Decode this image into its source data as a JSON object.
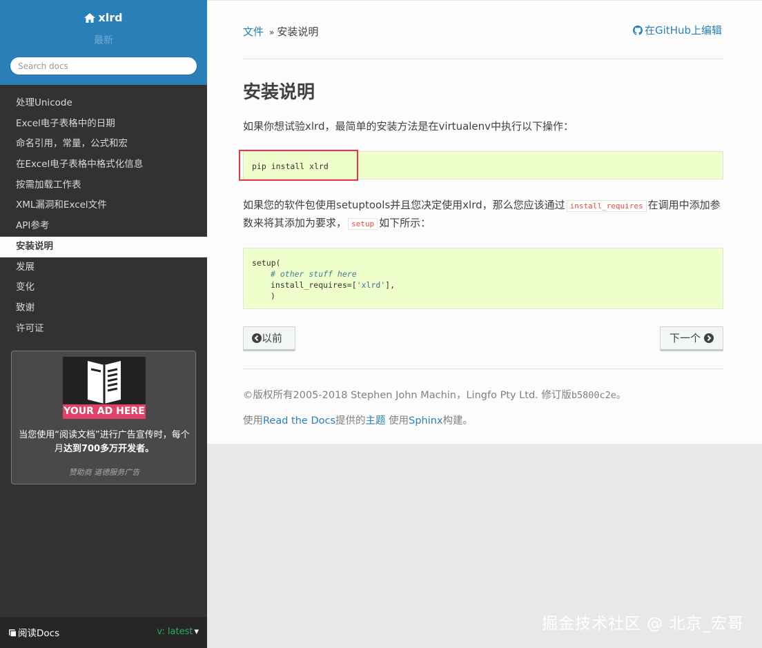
{
  "sidebar": {
    "project": "xlrd",
    "version": "最新",
    "search_placeholder": "Search docs",
    "nav": [
      {
        "label": "处理Unicode",
        "current": false
      },
      {
        "label": "Excel电子表格中的日期",
        "current": false
      },
      {
        "label": "命名引用，常量，公式和宏",
        "current": false
      },
      {
        "label": "在Excel电子表格中格式化信息",
        "current": false
      },
      {
        "label": "按需加载工作表",
        "current": false
      },
      {
        "label": "XML漏洞和Excel文件",
        "current": false
      },
      {
        "label": "API参考",
        "current": false
      },
      {
        "label": "安装说明",
        "current": true
      },
      {
        "label": "发展",
        "current": false
      },
      {
        "label": "变化",
        "current": false
      },
      {
        "label": "致谢",
        "current": false
      },
      {
        "label": "许可证",
        "current": false
      }
    ],
    "ad": {
      "banner": "YOUR AD HERE",
      "text_prefix": "当您使用“阅读文档”进行广告宣传时，每个月",
      "text_bold": "达到700多万开发者。",
      "footer": "赞助商 道德服务广告"
    },
    "footer": {
      "left": "阅读Docs",
      "version_prefix": "v:",
      "version": "latest"
    }
  },
  "content": {
    "breadcrumb_home": "文件",
    "breadcrumb_sep": "»",
    "breadcrumb_current": "安装说明",
    "edit_link": "在GitHub上编辑",
    "title": "安装说明",
    "para1": "如果你想试验xlrd，最简单的安装方法是在virtualenv中执行以下操作：",
    "code1": "pip install xlrd",
    "para2_a": "如果您的软件包使用setuptools并且您决定使用xlrd，那么您应该通过",
    "para2_code1": "install_requires",
    "para2_b": "在调用中添加参数来将其添加为要求，",
    "para2_code2": "setup",
    "para2_c": "如下所示：",
    "code2": {
      "line1": "setup(",
      "comment": "# other stuff here",
      "line3_a": "install_requires=[",
      "line3_str": "'xlrd'",
      "line3_b": "],",
      "line4": ")"
    },
    "prev_label": "以前",
    "next_label": "下一个",
    "footer_copyright": "©版权所有2005-2018 Stephen John Machin，Lingfo Pty Ltd. 修订版",
    "footer_revision": "b5800c2e",
    "footer_end": "。",
    "footer_built_a": "使用",
    "footer_rtd": "Read the Docs",
    "footer_built_b": "提供的",
    "footer_theme": "主题",
    "footer_built_c": " 使用",
    "footer_sphinx": "Sphinx",
    "footer_built_d": "构建。"
  },
  "watermark": "掘金技术社区 @ 北京_宏哥",
  "colors": {
    "sidebar_head": "#2980b9",
    "sidebar_bg": "#343131",
    "code_bg": "#eeffcc",
    "link": "#2980b9",
    "highlight_box": "#e0393e",
    "ad_banner": "#e0426a"
  }
}
